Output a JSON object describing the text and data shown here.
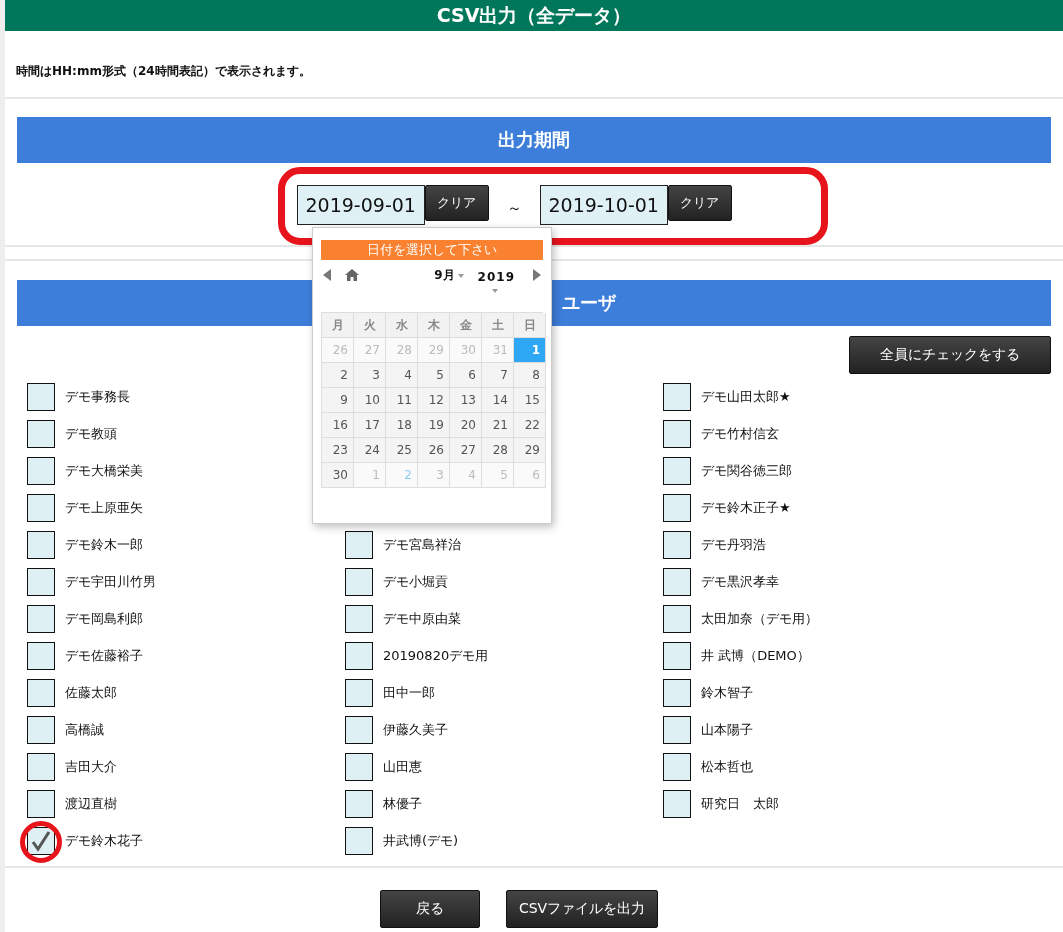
{
  "header": {
    "title": "CSV出力（全データ）"
  },
  "note": "時間はHH:mm形式（24時間表記）で表示されます。",
  "period": {
    "title": "出力期間",
    "from": {
      "value": "2019-09-01",
      "clear": "クリア"
    },
    "separator": "～",
    "to": {
      "value": "2019-10-01",
      "clear": "クリア"
    }
  },
  "datepicker": {
    "prompt": "日付を選択して下さい",
    "month": "9月",
    "year": "2019",
    "weekdays": [
      "月",
      "火",
      "水",
      "木",
      "金",
      "土",
      "日"
    ],
    "weeks": [
      [
        {
          "d": "26",
          "kind": "other",
          "selected": false
        },
        {
          "d": "27",
          "kind": "other",
          "selected": false
        },
        {
          "d": "28",
          "kind": "other",
          "selected": false
        },
        {
          "d": "29",
          "kind": "other",
          "selected": false
        },
        {
          "d": "30",
          "kind": "other",
          "selected": false
        },
        {
          "d": "31",
          "kind": "other",
          "selected": false
        },
        {
          "d": "1",
          "kind": "current",
          "selected": true
        }
      ],
      [
        {
          "d": "2",
          "kind": "current",
          "selected": false
        },
        {
          "d": "3",
          "kind": "current",
          "selected": false
        },
        {
          "d": "4",
          "kind": "current",
          "selected": false
        },
        {
          "d": "5",
          "kind": "current",
          "selected": false
        },
        {
          "d": "6",
          "kind": "current",
          "selected": false
        },
        {
          "d": "7",
          "kind": "current",
          "selected": false
        },
        {
          "d": "8",
          "kind": "current",
          "selected": false
        }
      ],
      [
        {
          "d": "9",
          "kind": "current",
          "selected": false
        },
        {
          "d": "10",
          "kind": "current",
          "selected": false
        },
        {
          "d": "11",
          "kind": "current",
          "selected": false
        },
        {
          "d": "12",
          "kind": "current",
          "selected": false
        },
        {
          "d": "13",
          "kind": "current",
          "selected": false
        },
        {
          "d": "14",
          "kind": "current",
          "selected": false
        },
        {
          "d": "15",
          "kind": "current",
          "selected": false
        }
      ],
      [
        {
          "d": "16",
          "kind": "current",
          "selected": false
        },
        {
          "d": "17",
          "kind": "current",
          "selected": false
        },
        {
          "d": "18",
          "kind": "current",
          "selected": false
        },
        {
          "d": "19",
          "kind": "current",
          "selected": false
        },
        {
          "d": "20",
          "kind": "current",
          "selected": false
        },
        {
          "d": "21",
          "kind": "current",
          "selected": false
        },
        {
          "d": "22",
          "kind": "current",
          "selected": false
        }
      ],
      [
        {
          "d": "23",
          "kind": "current",
          "selected": false
        },
        {
          "d": "24",
          "kind": "current",
          "selected": false
        },
        {
          "d": "25",
          "kind": "current",
          "selected": false
        },
        {
          "d": "26",
          "kind": "current",
          "selected": false
        },
        {
          "d": "27",
          "kind": "current",
          "selected": false
        },
        {
          "d": "28",
          "kind": "current",
          "selected": false
        },
        {
          "d": "29",
          "kind": "current",
          "selected": false
        }
      ],
      [
        {
          "d": "30",
          "kind": "current",
          "selected": false
        },
        {
          "d": "1",
          "kind": "other",
          "selected": false
        },
        {
          "d": "2",
          "kind": "today",
          "selected": false
        },
        {
          "d": "3",
          "kind": "other",
          "selected": false
        },
        {
          "d": "4",
          "kind": "other",
          "selected": false
        },
        {
          "d": "5",
          "kind": "other",
          "selected": false
        },
        {
          "d": "6",
          "kind": "other",
          "selected": false
        }
      ]
    ]
  },
  "users": {
    "title": "ユーザ",
    "check_all": "全員にチェックをする",
    "rows": [
      {
        "left": {
          "name": "デモ事務長",
          "checked": false
        },
        "right": {
          "name": "デモ山田太郎★",
          "checked": false
        }
      },
      {
        "left": {
          "name": "デモ教頭",
          "checked": false
        },
        "right": {
          "name": "デモ竹村信玄",
          "checked": false
        }
      },
      {
        "left": {
          "name": "デモ大橋栄美",
          "checked": false
        },
        "right": {
          "name": "デモ関谷徳三郎",
          "checked": false
        }
      },
      {
        "left": {
          "name": "デモ上原亜矢",
          "checked": false
        },
        "right": {
          "name": "デモ鈴木正子★",
          "checked": false
        }
      },
      {
        "left": {
          "name": "デモ鈴木一郎",
          "checked": false
        },
        "middle": {
          "name": "デモ宮島祥治",
          "checked": false
        },
        "right": {
          "name": "デモ丹羽浩",
          "checked": false
        }
      },
      {
        "left": {
          "name": "デモ宇田川竹男",
          "checked": false
        },
        "middle": {
          "name": "デモ小堀貢",
          "checked": false
        },
        "right": {
          "name": "デモ黒沢孝幸",
          "checked": false
        }
      },
      {
        "left": {
          "name": "デモ岡島利郎",
          "checked": false
        },
        "middle": {
          "name": "デモ中原由菜",
          "checked": false
        },
        "right": {
          "name": "太田加奈（デモ用）",
          "checked": false
        }
      },
      {
        "left": {
          "name": "デモ佐藤裕子",
          "checked": false
        },
        "middle": {
          "name": "20190820デモ用",
          "checked": false
        },
        "right": {
          "name": "井 武博（DEMO）",
          "checked": false
        }
      },
      {
        "left": {
          "name": "佐藤太郎",
          "checked": false
        },
        "middle": {
          "name": "田中一郎",
          "checked": false
        },
        "right": {
          "name": "鈴木智子",
          "checked": false
        }
      },
      {
        "left": {
          "name": "高橋誠",
          "checked": false
        },
        "middle": {
          "name": "伊藤久美子",
          "checked": false
        },
        "right": {
          "name": "山本陽子",
          "checked": false
        }
      },
      {
        "left": {
          "name": "吉田大介",
          "checked": false
        },
        "middle": {
          "name": "山田恵",
          "checked": false
        },
        "right": {
          "name": "松本哲也",
          "checked": false
        }
      },
      {
        "left": {
          "name": "渡辺直樹",
          "checked": false
        },
        "middle": {
          "name": "林優子",
          "checked": false
        },
        "right": {
          "name": "研究日　太郎",
          "checked": false
        }
      },
      {
        "left": {
          "name": "デモ鈴木花子",
          "checked": true
        },
        "middle": {
          "name": "井武博(デモ)",
          "checked": false
        }
      }
    ]
  },
  "buttons": {
    "back": "戻る",
    "export": "CSVファイルを出力"
  }
}
